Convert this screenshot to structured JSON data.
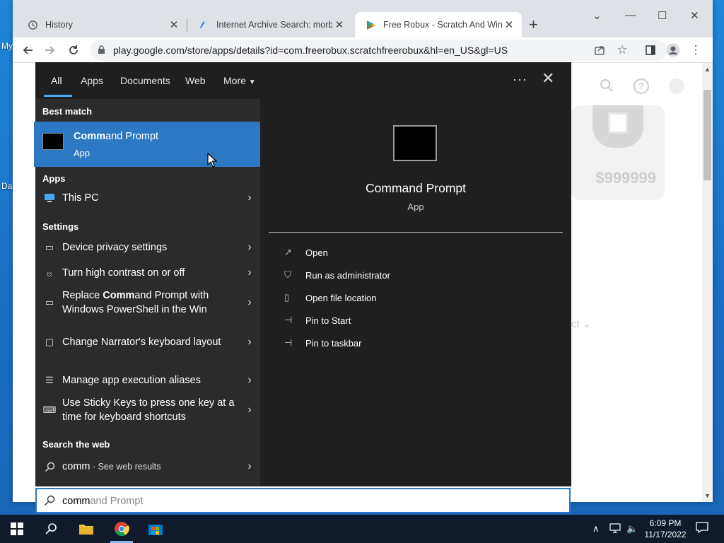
{
  "desktop": {
    "icon_label_1": "My",
    "icon_label_2": "Da"
  },
  "browser": {
    "tabs": [
      {
        "title": "History"
      },
      {
        "title": "Internet Archive Search: morbius"
      },
      {
        "title": "Free Robux - Scratch And Win - "
      }
    ],
    "url": "play.google.com/store/apps/details?id=com.freerobux.scratchfreerobux&hl=en_US&gl=US",
    "page_price": "$999999",
    "page_partial_text": "ct"
  },
  "search_menu": {
    "nav": [
      "All",
      "Apps",
      "Documents",
      "Web",
      "More"
    ],
    "sections": {
      "best_match": "Best match",
      "apps": "Apps",
      "settings": "Settings",
      "web": "Search the web"
    },
    "best_match": {
      "name_bold": "Comm",
      "name_rest": "and Prompt",
      "type": "App"
    },
    "apps": [
      {
        "label": "This PC"
      }
    ],
    "settings": [
      {
        "label": "Device privacy settings"
      },
      {
        "label": "Turn high contrast on or off"
      },
      {
        "label_pre": "Replace ",
        "label_bold": "Comm",
        "label_post": "and Prompt with Windows PowerShell in the Win"
      },
      {
        "label": "Change Narrator's keyboard layout"
      },
      {
        "label": "Manage app execution aliases"
      },
      {
        "label": "Use Sticky Keys to press one key at a time for keyboard shortcuts"
      }
    ],
    "web": {
      "query": "comm",
      "suffix": " - See web results"
    },
    "preview": {
      "title": "Command Prompt",
      "type": "App",
      "actions": [
        "Open",
        "Run as administrator",
        "Open file location",
        "Pin to Start",
        "Pin to taskbar"
      ]
    },
    "search": {
      "typed": "comm",
      "ghost": "and Prompt"
    }
  },
  "taskbar": {
    "time": "6:09 PM",
    "date": "11/17/2022"
  }
}
